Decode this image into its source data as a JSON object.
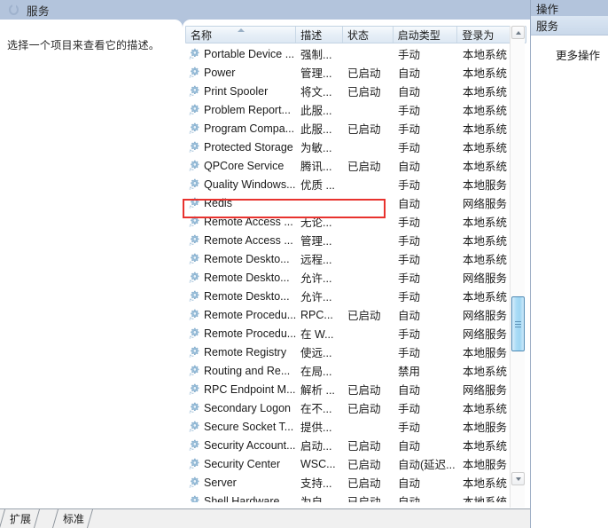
{
  "window": {
    "title": "服务",
    "title_icon": "services-icon"
  },
  "description_panel": {
    "text": "选择一个项目来查看它的描述。"
  },
  "list": {
    "columns": [
      {
        "key": "name",
        "label": "名称",
        "sorted": true
      },
      {
        "key": "desc",
        "label": "描述",
        "sorted": false
      },
      {
        "key": "status",
        "label": "状态",
        "sorted": false
      },
      {
        "key": "start",
        "label": "启动类型",
        "sorted": false
      },
      {
        "key": "logon",
        "label": "登录为",
        "sorted": false
      }
    ],
    "rows": [
      {
        "name": "Portable Device ...",
        "desc": "强制...",
        "status": "",
        "start": "手动",
        "logon": "本地系统"
      },
      {
        "name": "Power",
        "desc": "管理...",
        "status": "已启动",
        "start": "自动",
        "logon": "本地系统"
      },
      {
        "name": "Print Spooler",
        "desc": "将文...",
        "status": "已启动",
        "start": "自动",
        "logon": "本地系统"
      },
      {
        "name": "Problem Report...",
        "desc": "此服...",
        "status": "",
        "start": "手动",
        "logon": "本地系统"
      },
      {
        "name": "Program Compa...",
        "desc": "此服...",
        "status": "已启动",
        "start": "手动",
        "logon": "本地系统"
      },
      {
        "name": "Protected Storage",
        "desc": "为敏...",
        "status": "",
        "start": "手动",
        "logon": "本地系统"
      },
      {
        "name": "QPCore Service",
        "desc": "腾讯...",
        "status": "已启动",
        "start": "自动",
        "logon": "本地系统"
      },
      {
        "name": "Quality Windows...",
        "desc": "优质 ...",
        "status": "",
        "start": "手动",
        "logon": "本地服务"
      },
      {
        "name": "Redis",
        "desc": "",
        "status": "",
        "start": "自动",
        "logon": "网络服务"
      },
      {
        "name": "Remote Access ...",
        "desc": "无论...",
        "status": "",
        "start": "手动",
        "logon": "本地系统"
      },
      {
        "name": "Remote Access ...",
        "desc": "管理...",
        "status": "",
        "start": "手动",
        "logon": "本地系统"
      },
      {
        "name": "Remote Deskto...",
        "desc": "远程...",
        "status": "",
        "start": "手动",
        "logon": "本地系统"
      },
      {
        "name": "Remote Deskto...",
        "desc": "允许...",
        "status": "",
        "start": "手动",
        "logon": "网络服务"
      },
      {
        "name": "Remote Deskto...",
        "desc": "允许...",
        "status": "",
        "start": "手动",
        "logon": "本地系统"
      },
      {
        "name": "Remote Procedu...",
        "desc": "RPC...",
        "status": "已启动",
        "start": "自动",
        "logon": "网络服务"
      },
      {
        "name": "Remote Procedu...",
        "desc": "在 W...",
        "status": "",
        "start": "手动",
        "logon": "网络服务"
      },
      {
        "name": "Remote Registry",
        "desc": "使远...",
        "status": "",
        "start": "手动",
        "logon": "本地服务"
      },
      {
        "name": "Routing and Re...",
        "desc": "在局...",
        "status": "",
        "start": "禁用",
        "logon": "本地系统"
      },
      {
        "name": "RPC Endpoint M...",
        "desc": "解析 ...",
        "status": "已启动",
        "start": "自动",
        "logon": "网络服务"
      },
      {
        "name": "Secondary Logon",
        "desc": "在不...",
        "status": "已启动",
        "start": "手动",
        "logon": "本地系统"
      },
      {
        "name": "Secure Socket T...",
        "desc": "提供...",
        "status": "",
        "start": "手动",
        "logon": "本地服务"
      },
      {
        "name": "Security Account...",
        "desc": "启动...",
        "status": "已启动",
        "start": "自动",
        "logon": "本地系统"
      },
      {
        "name": "Security Center",
        "desc": "WSC...",
        "status": "已启动",
        "start": "自动(延迟...",
        "logon": "本地服务"
      },
      {
        "name": "Server",
        "desc": "支持...",
        "status": "已启动",
        "start": "自动",
        "logon": "本地系统"
      },
      {
        "name": "Shell Hardware...",
        "desc": "为自...",
        "status": "已启动",
        "start": "自动",
        "logon": "本地系统"
      }
    ],
    "highlighted_row_name": "Redis",
    "highlight_color": "#e8322e"
  },
  "scrollbar": {
    "up_arrow": "scroll-up-icon",
    "down_arrow": "scroll-down-icon",
    "thumb_position_percent": 58
  },
  "tabs": [
    {
      "label": "扩展"
    },
    {
      "label": "标准"
    }
  ],
  "actions_pane": {
    "title": "操作",
    "group_label": "服务",
    "more_label": "更多操作"
  }
}
